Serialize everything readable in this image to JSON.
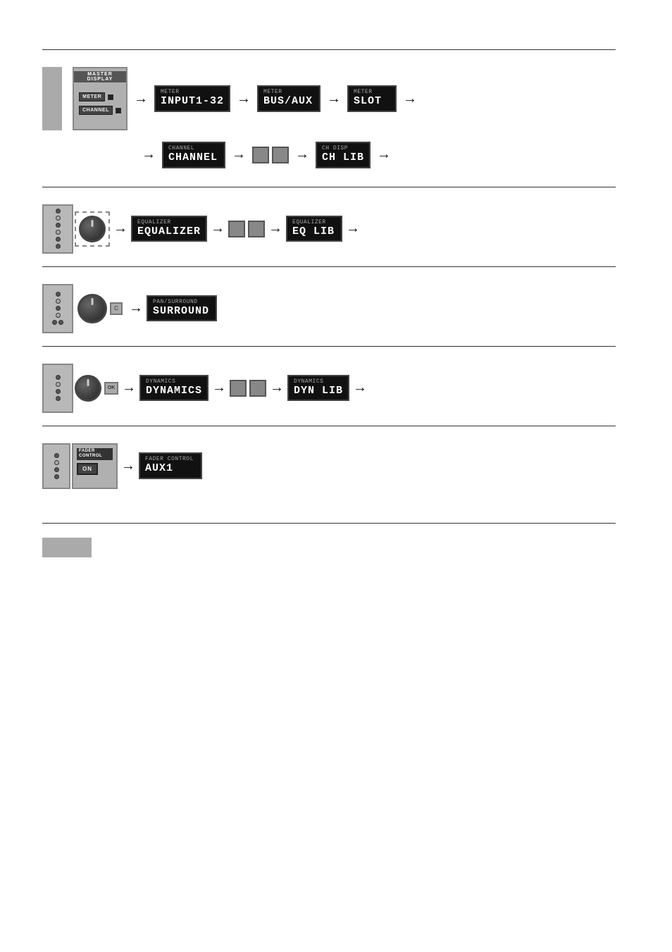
{
  "page": {
    "background": "#ffffff"
  },
  "sections": [
    {
      "id": "master-display",
      "side_label": "",
      "rows": [
        {
          "id": "meter-row",
          "items": [
            {
              "type": "hw-panel",
              "name": "master-display-panel"
            },
            {
              "type": "arrow"
            },
            {
              "type": "lcd",
              "label": "METER",
              "value": "INPUT1-32"
            },
            {
              "type": "arrow"
            },
            {
              "type": "lcd",
              "label": "METER",
              "value": "BUS/AUX"
            },
            {
              "type": "arrow"
            },
            {
              "type": "lcd",
              "label": "METER",
              "value": "SLOT"
            },
            {
              "type": "arrow"
            }
          ]
        },
        {
          "id": "channel-row",
          "items": [
            {
              "type": "arrow"
            },
            {
              "type": "lcd",
              "label": "CHANNEL",
              "value": "CHANNEL"
            },
            {
              "type": "arrow"
            },
            {
              "type": "btn-pair"
            },
            {
              "type": "arrow"
            },
            {
              "type": "lcd",
              "label": "CH DISP",
              "value": "CH LIB"
            },
            {
              "type": "arrow"
            }
          ]
        }
      ]
    },
    {
      "id": "equalizer",
      "rows": [
        {
          "id": "eq-row",
          "items": [
            {
              "type": "eq-hw-panel"
            },
            {
              "type": "arrow"
            },
            {
              "type": "lcd",
              "label": "EQUALIZER",
              "value": "EQUALIZER"
            },
            {
              "type": "arrow"
            },
            {
              "type": "btn-pair"
            },
            {
              "type": "arrow"
            },
            {
              "type": "lcd",
              "label": "EQUALIZER",
              "value": "EQ LIB"
            },
            {
              "type": "arrow"
            }
          ]
        }
      ]
    },
    {
      "id": "surround",
      "rows": [
        {
          "id": "surround-row",
          "items": [
            {
              "type": "surround-hw-panel"
            },
            {
              "type": "arrow"
            },
            {
              "type": "lcd",
              "label": "PAN/SURROUND",
              "value": "SURROUND"
            }
          ]
        }
      ]
    },
    {
      "id": "dynamics",
      "rows": [
        {
          "id": "dynamics-row",
          "items": [
            {
              "type": "dynamics-hw-panel"
            },
            {
              "type": "arrow"
            },
            {
              "type": "lcd",
              "label": "DYNAMICS",
              "value": "DYNAMICS"
            },
            {
              "type": "arrow"
            },
            {
              "type": "btn-pair"
            },
            {
              "type": "arrow"
            },
            {
              "type": "lcd",
              "label": "DYNAMICS",
              "value": "DYN LIB"
            },
            {
              "type": "arrow"
            }
          ]
        }
      ]
    },
    {
      "id": "fader-control",
      "rows": [
        {
          "id": "fader-row",
          "items": [
            {
              "type": "fader-hw-panel"
            },
            {
              "type": "arrow"
            },
            {
              "type": "lcd",
              "label": "FADER CONTROL",
              "value": "AUX1"
            }
          ]
        }
      ]
    }
  ],
  "labels": {
    "meter": "METER",
    "input132": "INPUT1-32",
    "busaux": "BUS/AUX",
    "slot": "SLOT",
    "channel_label": "CHANNEL",
    "channel_value": "CHANNEL",
    "ch_disp": "CH DISP",
    "ch_lib": "CH LIB",
    "equalizer_label": "EQUALIZER",
    "equalizer_value": "EQUALIZER",
    "eq_lib_label": "EQUALIZER",
    "eq_lib_value": "EQ LIB",
    "pan_surround": "PAN/SURROUND",
    "surround_value": "SURROUND",
    "dynamics_label": "DYNAMICS",
    "dynamics_value": "DYNAMICS",
    "dyn_lib_label": "DYNAMICS",
    "dyn_lib_value": "DYN LIB",
    "fader_control_label": "FADER CONTROL",
    "fader_control_value": "AUX1",
    "meter_btn": "METER",
    "channel_btn": "CHANNEL",
    "master_display_title": "MASTER DISPLAY",
    "on_btn": "ON"
  }
}
